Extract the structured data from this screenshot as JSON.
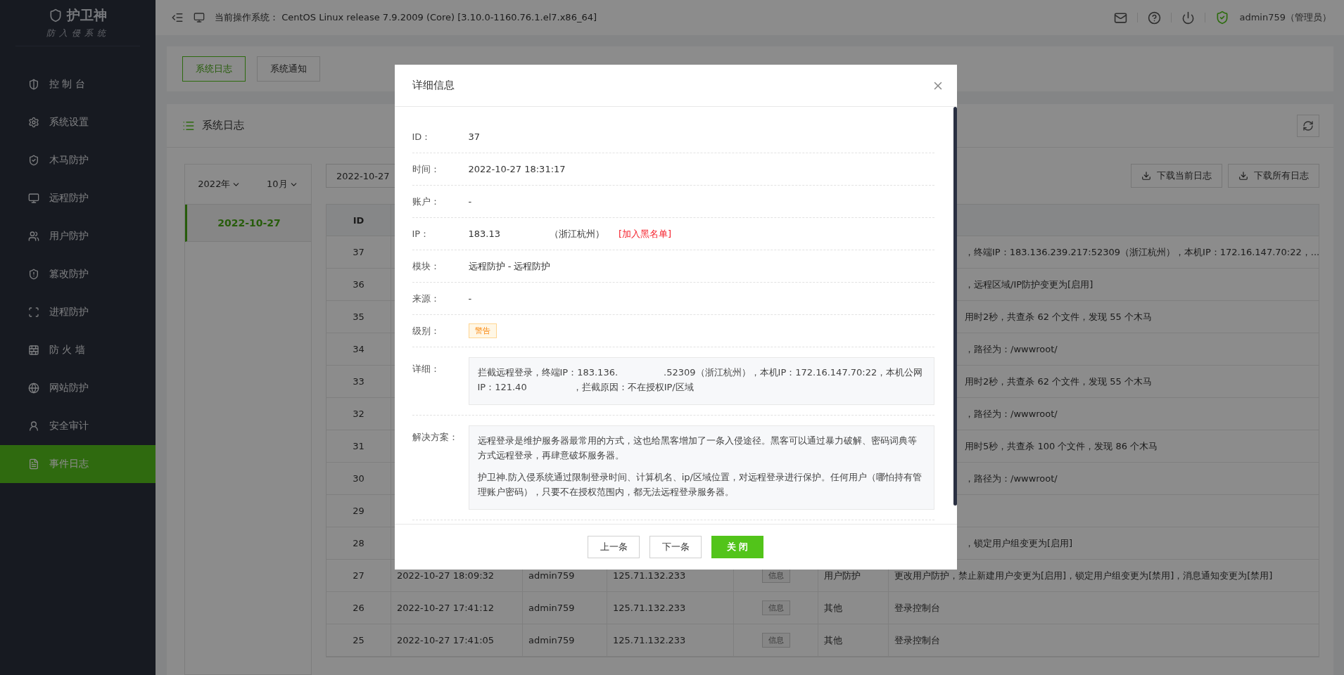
{
  "brand": {
    "name": "护卫神",
    "subtitle": "防入侵系统"
  },
  "sidebar": {
    "items": [
      {
        "label": "控 制 台",
        "selected": false
      },
      {
        "label": "系统设置",
        "selected": false
      },
      {
        "label": "木马防护",
        "selected": false
      },
      {
        "label": "远程防护",
        "selected": false
      },
      {
        "label": "用户防护",
        "selected": false
      },
      {
        "label": "篡改防护",
        "selected": false
      },
      {
        "label": "进程防护",
        "selected": false
      },
      {
        "label": "防 火 墙",
        "selected": false
      },
      {
        "label": "网站防护",
        "selected": false
      },
      {
        "label": "安全审计",
        "selected": false
      },
      {
        "label": "事件日志",
        "selected": true
      }
    ]
  },
  "topbar": {
    "os_label": "当前操作系统：",
    "os_value": "CentOS Linux release 7.9.2009 (Core) [3.10.0-1160.76.1.el7.x86_64]",
    "user": "admin759（管理员）"
  },
  "tabs": [
    {
      "label": "系统日志",
      "selected": true
    },
    {
      "label": "系统通知",
      "selected": false
    }
  ],
  "card_title": "系统日志",
  "date_panel": {
    "year": "2022年",
    "month": "10月",
    "dates": [
      {
        "label": "2022-10-27",
        "selected": true
      }
    ]
  },
  "filter": {
    "date_range": "2022-10-27"
  },
  "downloads": [
    "下载当前日志",
    "下载所有日志"
  ],
  "table": {
    "columns": [
      "ID"
    ],
    "rows": [
      {
        "id": "37",
        "detail_tail": "，终端IP：183.136.239.217:52309（浙江杭州），本机IP：172.16.147.70:22，..."
      },
      {
        "id": "36",
        "detail_tail": "，远程区域/IP防护变更为[启用]"
      },
      {
        "id": "35",
        "detail_tail": "用时2秒，共查杀 62 个文件，发现 55 个木马"
      },
      {
        "id": "34",
        "detail_tail": "，路径为：/wwwroot/"
      },
      {
        "id": "33",
        "detail_tail": "用时2秒，共查杀 62 个文件，发现 55 个木马"
      },
      {
        "id": "32",
        "detail_tail": "，路径为：/wwwroot/"
      },
      {
        "id": "31",
        "detail_tail": "用时5秒，共查杀 100 个文件，发现 86 个木马"
      },
      {
        "id": "30",
        "detail_tail": "，路径为：/wwwroot/"
      },
      {
        "id": "29"
      },
      {
        "id": "28",
        "detail_tail": "，锁定用户组变更为[启用]"
      },
      {
        "id": "27",
        "time": "2022-10-27 18:09:32",
        "account": "admin759",
        "ip": "125.71.132.233",
        "level": {
          "text": "信息",
          "kind": "info"
        },
        "module": "用户防护",
        "detail": "更改用户防护，禁止新建用户变更为[启用]，锁定用户组变更为[禁用]，消息通知变更为[禁用]"
      },
      {
        "id": "26",
        "time": "2022-10-27 17:41:12",
        "account": "admin759",
        "ip": "125.71.132.233",
        "level": {
          "text": "信息",
          "kind": "info"
        },
        "module": "其他",
        "detail": "登录控制台"
      },
      {
        "id": "25",
        "time": "2022-10-27 17:41:05",
        "account": "admin759",
        "ip": "125.71.132.233",
        "level": {
          "text": "信息",
          "kind": "info"
        },
        "module": "其他",
        "detail": "登录控制台"
      }
    ]
  },
  "modal": {
    "title": "详细信息",
    "fields": [
      {
        "label": "ID：",
        "kind": "text",
        "value": "37"
      },
      {
        "label": "时间：",
        "kind": "text",
        "value": "2022-10-27 18:31:17"
      },
      {
        "label": "账户：",
        "kind": "text",
        "value": "-"
      },
      {
        "label": "IP：",
        "kind": "ip",
        "value": "183.13",
        "location": "（浙江杭州）",
        "action": "[加入黑名单]"
      },
      {
        "label": "模块：",
        "kind": "text",
        "value": "远程防护 - 远程防护"
      },
      {
        "label": "来源：",
        "kind": "text",
        "value": "-"
      },
      {
        "label": "级别：",
        "kind": "tag",
        "tag": {
          "text": "警告",
          "kind": "warning"
        }
      },
      {
        "label": "详细：",
        "kind": "box",
        "paragraphs": [
          "拦截远程登录，终端IP：183.136.　　　　　.52309（浙江杭州），本机IP：172.16.147.70:22，本机公网IP：121.40　　　　　，拦截原因：不在授权IP/区域"
        ]
      },
      {
        "label": "解决方案：",
        "kind": "box",
        "paragraphs": [
          "远程登录是维护服务器最常用的方式，这也给黑客增加了一条入侵途径。黑客可以通过暴力破解、密码词典等方式远程登录，再肆意破坏服务器。",
          "护卫神.防入侵系统通过限制登录时间、计算机名、ip/区域位置，对远程登录进行保护。任何用户（哪怕持有管理账户密码），只要不在授权范围内，都无法远程登录服务器。"
        ]
      }
    ],
    "buttons": [
      {
        "label": "上一条",
        "kind": "default"
      },
      {
        "label": "下一条",
        "kind": "default"
      },
      {
        "label": "关 闭",
        "kind": "primary"
      }
    ]
  }
}
